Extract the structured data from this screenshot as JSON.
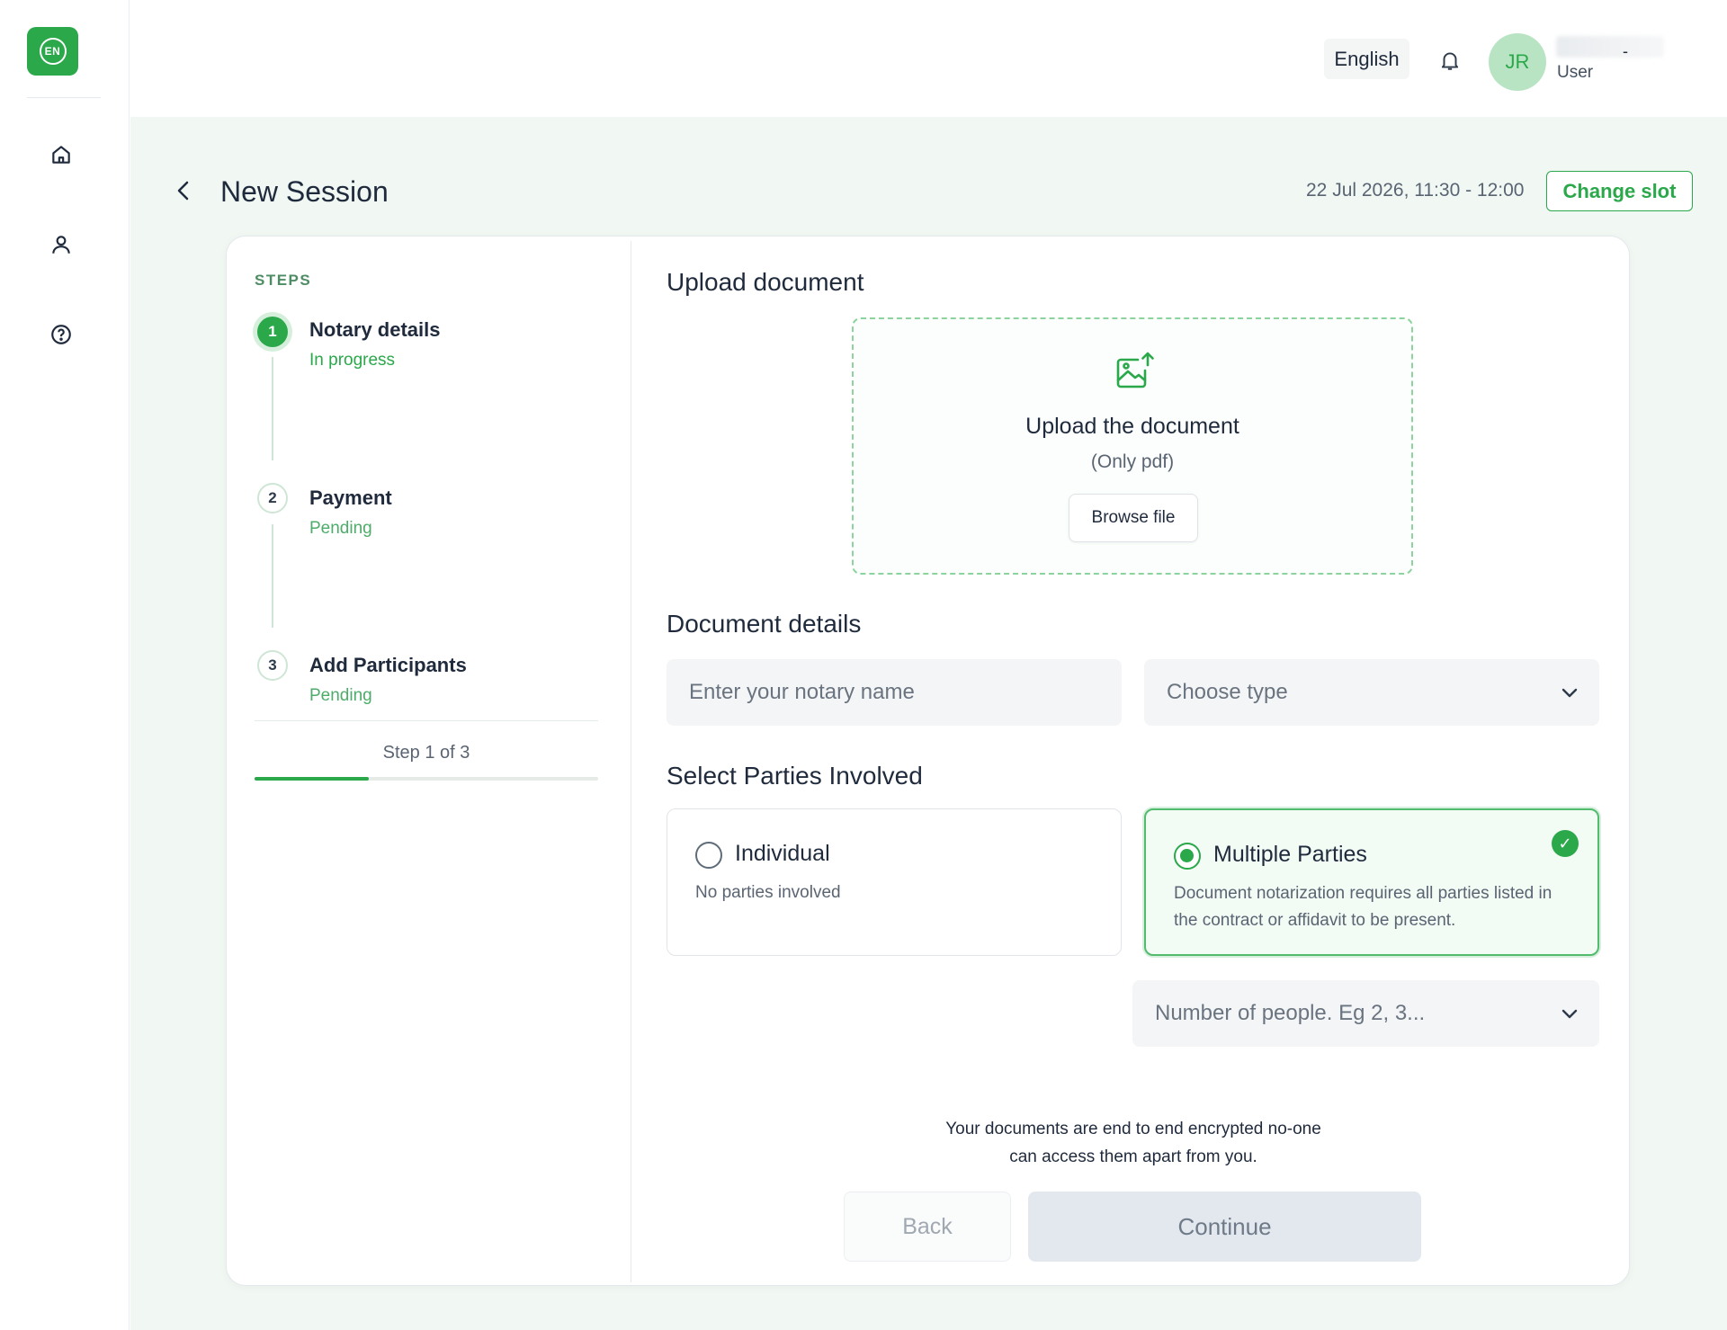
{
  "brand": {
    "logo_text": "EN",
    "accent": "#2aa84a"
  },
  "sidebar": {
    "items": [
      {
        "name": "home",
        "icon": "home-icon"
      },
      {
        "name": "profile",
        "icon": "user-icon"
      },
      {
        "name": "help",
        "icon": "help-icon"
      }
    ]
  },
  "header": {
    "language": "English",
    "notification_icon": "bell-icon",
    "user": {
      "initials": "JR",
      "name_separator": "-",
      "role": "User"
    }
  },
  "page": {
    "title": "New Session",
    "slot_time": "22 Jul 2026, 11:30 - 12:00",
    "change_slot_label": "Change slot"
  },
  "steps": {
    "label": "STEPS",
    "items": [
      {
        "number": "1",
        "title": "Notary details",
        "status": "In progress"
      },
      {
        "number": "2",
        "title": "Payment",
        "status": "Pending"
      },
      {
        "number": "3",
        "title": "Add Participants",
        "status": "Pending"
      }
    ],
    "counter": "Step 1 of 3",
    "progress": 0.333
  },
  "upload": {
    "section_title": "Upload document",
    "title": "Upload the document",
    "subtitle": "(Only pdf)",
    "browse_label": "Browse file"
  },
  "details": {
    "section_title": "Document details",
    "notary_placeholder": "Enter your notary name",
    "type_placeholder": "Choose type"
  },
  "parties": {
    "section_title": "Select Parties Involved",
    "options": [
      {
        "title": "Individual",
        "desc": "No parties involved",
        "selected": false
      },
      {
        "title": "Multiple Parties",
        "desc": "Document notarization requires all parties listed in the contract or affidavit to be present.",
        "selected": true
      }
    ],
    "people_placeholder": "Number of people. Eg 2, 3..."
  },
  "footer": {
    "secure_note_line1": "Your documents are end to end encrypted no-one",
    "secure_note_line2": "can access them apart from you.",
    "back_label": "Back",
    "continue_label": "Continue"
  }
}
